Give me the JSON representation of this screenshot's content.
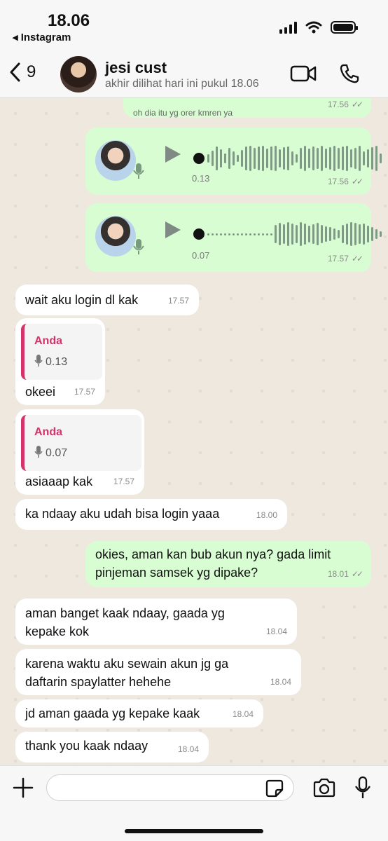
{
  "status_bar": {
    "time": "18.06",
    "back_app": "◂ Instagram"
  },
  "header": {
    "back_count": "9",
    "contact_name": "jesi cust",
    "last_seen": "akhir dilihat hari ini pukul 18.06"
  },
  "messages": [
    {
      "type": "partial-out",
      "text": "oh dia itu yg orer kmren ya",
      "time": "17.56"
    },
    {
      "type": "voice-out",
      "duration": "0.13",
      "time": "17.56"
    },
    {
      "type": "voice-out",
      "duration": "0.07",
      "time": "17.57"
    },
    {
      "type": "text-in",
      "text": "wait aku login dl kak",
      "time": "17.57"
    },
    {
      "type": "reply-in",
      "quote_author": "Anda",
      "quote_duration": "0.13",
      "text": "okeei",
      "time": "17.57"
    },
    {
      "type": "reply-in",
      "quote_author": "Anda",
      "quote_duration": "0.07",
      "text": "asiaaap kak",
      "time": "17.57"
    },
    {
      "type": "text-in",
      "text": "ka ndaay aku udah bisa login yaaa",
      "time": "18.00"
    },
    {
      "type": "text-out",
      "line1": "okies, aman kan bub akun nya? gada limit",
      "line2": "pinjeman samsek yg dipake?",
      "time": "18.01"
    },
    {
      "type": "text-in",
      "line1": "aman banget kaak ndaay, gaada yg",
      "line2": "kepake kok",
      "time": "18.04"
    },
    {
      "type": "text-in",
      "line1": "karena waktu aku sewain akun jg ga",
      "line2": "daftarin spaylatter hehehe",
      "time": "18.04"
    },
    {
      "type": "text-in",
      "text": "jd aman gaada yg kepake kaak",
      "time": "18.04"
    },
    {
      "type": "text-in",
      "text": "thank you kaak ndaay",
      "time": "18.04"
    }
  ],
  "composer": {
    "placeholder": ""
  },
  "colors": {
    "outgoing": "#d9fdd3",
    "incoming": "#ffffff",
    "quote_accent": "#d4326b",
    "wallpaper": "#eee8df"
  }
}
